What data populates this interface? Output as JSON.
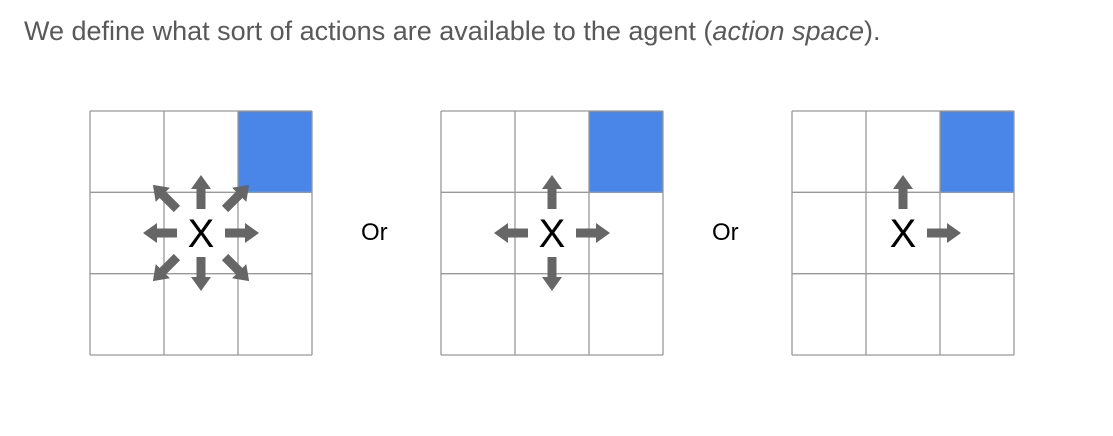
{
  "caption": {
    "prefix": "We define what sort of actions are available to the agent (",
    "italic": "action space",
    "suffix": ")."
  },
  "colors": {
    "goal": "#4a86e8",
    "arrow": "#666666",
    "grid_line": "#999999",
    "text": "#595959"
  },
  "separators": [
    "Or",
    "Or"
  ],
  "grids": [
    {
      "agent_label": "X",
      "goal_cell": "top-right",
      "actions": [
        "up",
        "down",
        "left",
        "right",
        "up-left",
        "up-right",
        "down-left",
        "down-right"
      ]
    },
    {
      "agent_label": "X",
      "goal_cell": "top-right",
      "actions": [
        "up",
        "down",
        "left",
        "right"
      ]
    },
    {
      "agent_label": "X",
      "goal_cell": "top-right",
      "actions": [
        "up",
        "right"
      ]
    }
  ]
}
